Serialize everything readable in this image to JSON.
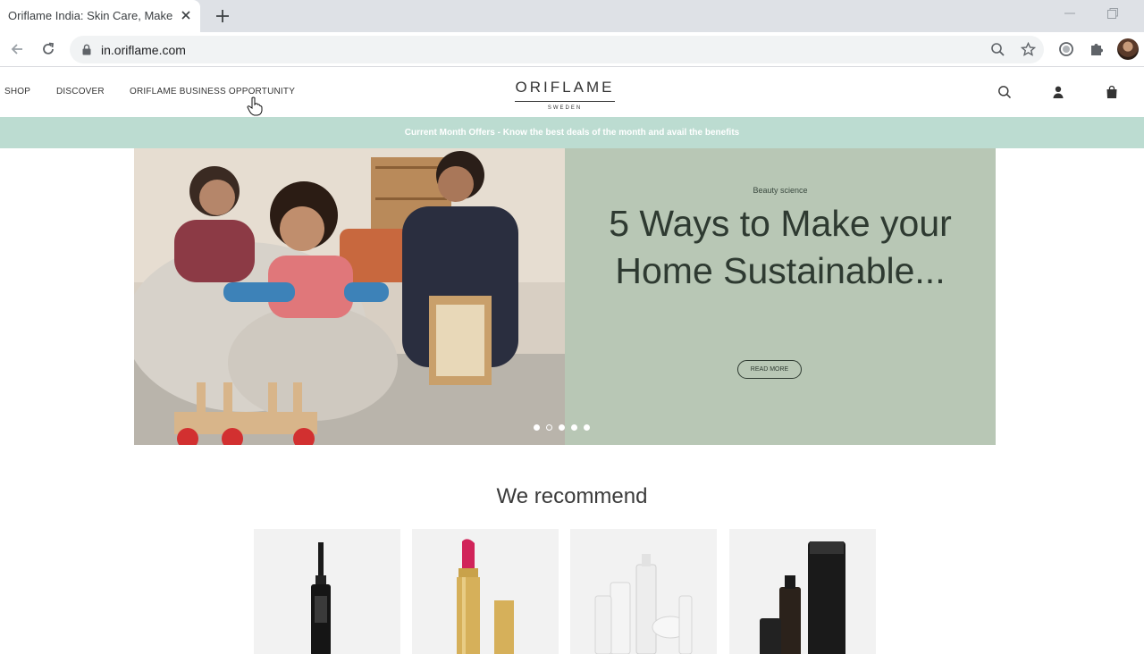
{
  "browser": {
    "tab_title": "Oriflame India: Skin Care, Makeup",
    "url": "in.oriflame.com"
  },
  "header": {
    "nav": [
      "SHOP",
      "DISCOVER",
      "ORIFLAME BUSINESS OPPORTUNITY"
    ],
    "logo_main": "ORIFLAME",
    "logo_sub": "SWEDEN"
  },
  "promo": {
    "text": "Current Month Offers - Know the best deals of the month and avail the benefits",
    "background": "#bcdcd1"
  },
  "hero": {
    "kicker": "Beauty science",
    "title": "5 Ways to Make your Home Sustainable...",
    "button": "READ MORE",
    "panel_color": "#b8c7b5",
    "slide_count": 5,
    "active_slide": 2
  },
  "recommend": {
    "title": "We recommend",
    "products": [
      {
        "icon": "mascara-icon"
      },
      {
        "icon": "lipstick-icon"
      },
      {
        "icon": "skincare-set-icon"
      },
      {
        "icon": "men-skincare-set-icon"
      }
    ]
  }
}
